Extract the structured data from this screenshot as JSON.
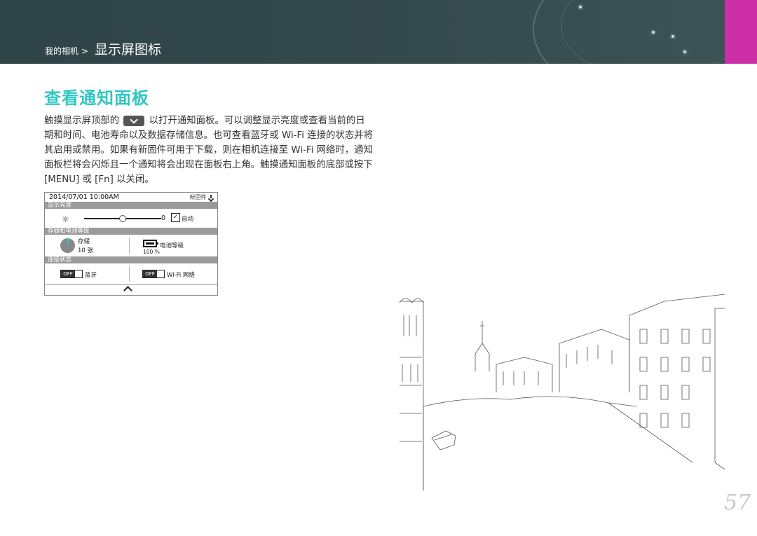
{
  "header": {
    "breadcrumb_small": "我的相机 >",
    "breadcrumb_large": "显示屏图标"
  },
  "section": {
    "title": "查看通知面板",
    "paragraph_before_icon": "触摸显示屏顶部的",
    "paragraph_after_icon": "以打开通知面板。可以调整显示亮度或查看当前的日期和时间、电池寿命以及数据存储信息。也可查看蓝牙或 Wi-Fi 连接的状态并将其启用或禁用。如果有新固件可用于下载，则在相机连接至 Wi-Fi 网络时，通知面板栏将会闪烁且一个通知将会出现在面板右上角。触摸通知面板的底部或按下 [MENU] 或 [Fn] 以关闭。"
  },
  "panel": {
    "datetime": "2014/07/01  10:00AM",
    "firmware_label": "新固件",
    "brightness_header": "显示亮度",
    "brightness_value": "0",
    "brightness_level": 0.5,
    "auto_label": "自动",
    "auto_checked": "✓",
    "storage_header": "存储和电池等级",
    "storage_label": "存储",
    "storage_value": "10 张",
    "battery_label": "电池等级",
    "battery_percent": "100 %",
    "connection_header": "连接状态",
    "bluetooth_state": "OFF",
    "bluetooth_label": "蓝牙",
    "wifi_state": "OFF",
    "wifi_label": "Wi-Fi 网络"
  },
  "colors": {
    "title": "#2ec7c3",
    "banner": "#34494c",
    "accent_tab": "#cc2fa5"
  },
  "page_number": "57"
}
